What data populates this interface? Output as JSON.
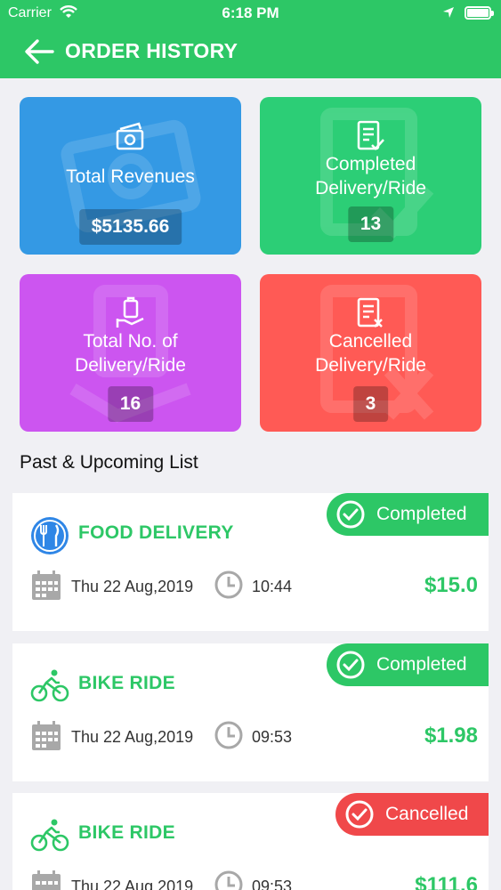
{
  "status_bar": {
    "carrier": "Carrier",
    "time": "6:18 PM"
  },
  "header": {
    "title": "ORDER HISTORY"
  },
  "stats": [
    {
      "label": "Total Revenues",
      "value": "$5135.66",
      "icon": "money-icon"
    },
    {
      "label": "Completed Delivery/Ride",
      "value": "13",
      "icon": "checklist-icon"
    },
    {
      "label": "Total No. of Delivery/Ride",
      "value": "16",
      "icon": "delivery-bag-icon"
    },
    {
      "label": "Cancelled Delivery/Ride",
      "value": "3",
      "icon": "cancel-list-icon"
    }
  ],
  "list": {
    "title": "Past & Upcoming List",
    "items": [
      {
        "service": "FOOD DELIVERY",
        "status": "Completed",
        "date": "Thu 22 Aug,2019",
        "time": "10:44",
        "price": "$15.0",
        "icon": "food-icon"
      },
      {
        "service": "BIKE RIDE",
        "status": "Completed",
        "date": "Thu 22 Aug,2019",
        "time": "09:53",
        "price": "$1.98",
        "icon": "bike-icon"
      },
      {
        "service": "BIKE RIDE",
        "status": "Cancelled",
        "date": "Thu 22 Aug,2019",
        "time": "09:53",
        "price": "$111.6",
        "icon": "bike-icon"
      }
    ]
  },
  "colors": {
    "header": "#2dc766",
    "completed": "#2dc766",
    "cancelled": "#f0484a",
    "revenue": "#3499e4",
    "completed_card": "#2cce76",
    "total_card": "#cc55f0",
    "cancelled_card": "#ff5a55"
  }
}
